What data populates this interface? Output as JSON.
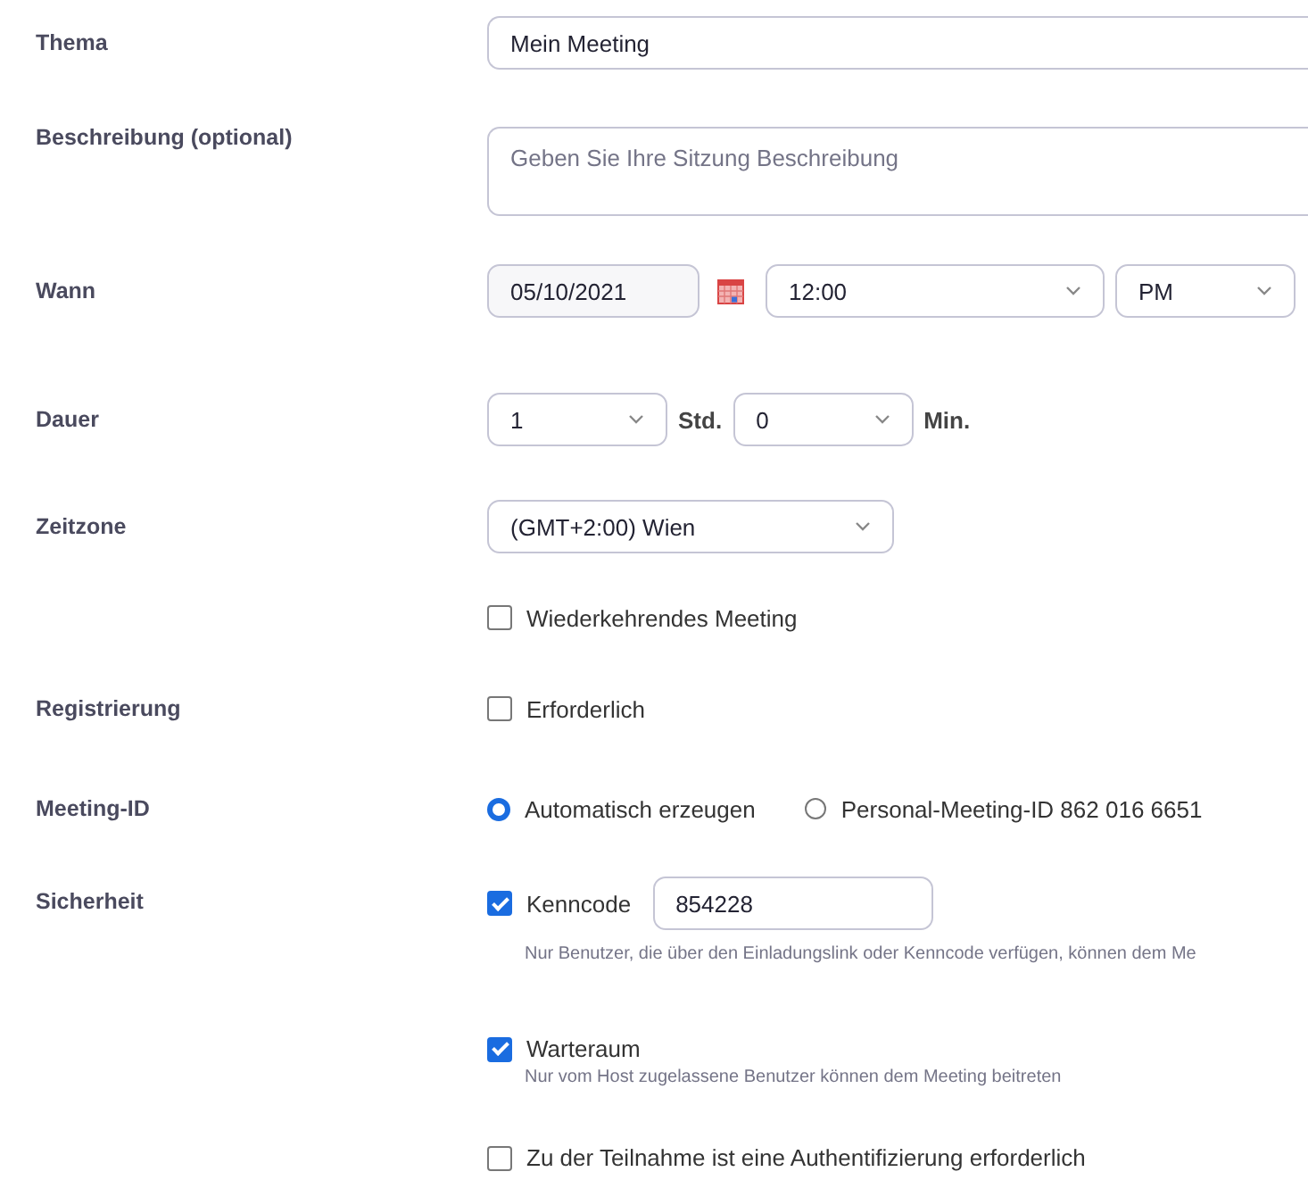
{
  "rows": [
    {
      "label": "Thema",
      "controls": [
        {
          "kind": "text",
          "value": "Mein Meeting"
        }
      ]
    },
    {
      "label": "Beschreibung (optional)",
      "controls": [
        {
          "kind": "textarea",
          "placeholder": "Geben Sie Ihre Sitzung Beschreibung"
        }
      ]
    },
    {
      "label": "Wann",
      "controls": [
        {
          "kind": "date",
          "value": "05/10/2021"
        },
        {
          "kind": "select",
          "value": "12:00"
        },
        {
          "kind": "select",
          "value": "PM"
        }
      ]
    },
    {
      "label": "Dauer",
      "controls": [
        {
          "kind": "select",
          "value": "1"
        },
        {
          "kind": "unit",
          "text": "Std."
        },
        {
          "kind": "select",
          "value": "0"
        },
        {
          "kind": "unit",
          "text": "Min."
        }
      ]
    },
    {
      "label": "Zeitzone",
      "controls": [
        {
          "kind": "select",
          "value": "(GMT+2:00) Wien"
        }
      ]
    },
    {
      "controls": [
        {
          "kind": "checkbox",
          "text": "Wiederkehrendes Meeting",
          "checked": false
        }
      ]
    },
    {
      "label": "Registrierung",
      "controls": [
        {
          "kind": "checkbox",
          "text": "Erforderlich",
          "checked": false
        }
      ]
    },
    {
      "label": "Meeting-ID",
      "controls": [
        {
          "kind": "radio",
          "text": "Automatisch erzeugen",
          "selected": true
        },
        {
          "kind": "radio",
          "text": "Personal-Meeting-ID 862 016 6651",
          "selected": false
        }
      ]
    },
    {
      "label": "Sicherheit",
      "kind": "stack",
      "controls": [
        {
          "kind": "checkbox",
          "text": "Kenncode",
          "checked": true,
          "value": "854228",
          "hint": "Nur Benutzer, die über den Einladungslink oder Kenncode verfügen, können dem Me"
        },
        {
          "kind": "checkbox",
          "text": "Warteraum",
          "checked": true,
          "hint": "Nur vom Host zugelassene Benutzer können dem Meeting beitreten"
        },
        {
          "kind": "checkbox",
          "text": "Zu der Teilnahme ist eine Authentifizierung erforderlich",
          "checked": false
        }
      ]
    }
  ]
}
